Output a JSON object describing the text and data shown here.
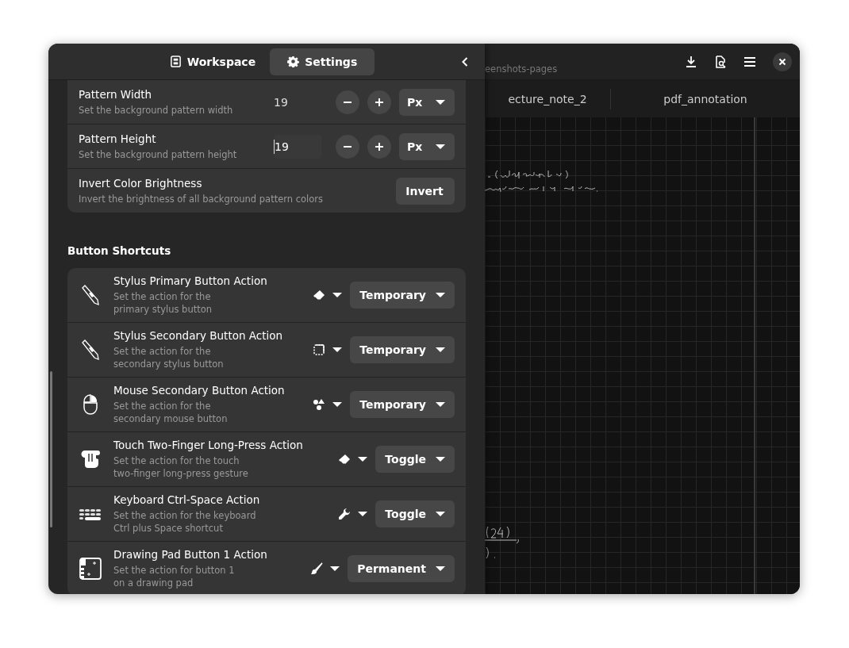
{
  "sidebar_tabs": [
    {
      "label": "Workspace",
      "selected": false
    },
    {
      "label": "Settings",
      "selected": true
    }
  ],
  "pattern_settings": [
    {
      "kind": "spin",
      "title": "Pattern Width",
      "subtitle": "Set the background pattern width",
      "value": "19",
      "unit": "Px",
      "focused": false
    },
    {
      "kind": "spin",
      "title": "Pattern Height",
      "subtitle": "Set the background pattern height",
      "value": "19",
      "unit": "Px",
      "focused": true
    },
    {
      "kind": "button",
      "title": "Invert Color Brightness",
      "subtitle": "Invert the brightness of all background pattern colors",
      "button": "Invert"
    }
  ],
  "section_heading": "Button Shortcuts",
  "shortcuts": [
    {
      "title": "Stylus Primary Button Action",
      "subtitle_lines": [
        "Set the action for the",
        "primary stylus button"
      ],
      "mode": "Temporary"
    },
    {
      "title": "Stylus Secondary Button Action",
      "subtitle_lines": [
        "Set the action for the",
        "secondary stylus button"
      ],
      "mode": "Temporary"
    },
    {
      "title": "Mouse Secondary Button Action",
      "subtitle_lines": [
        "Set the action for the",
        "secondary mouse button"
      ],
      "mode": "Temporary"
    },
    {
      "title": "Touch Two-Finger Long-Press Action",
      "subtitle_lines": [
        "Set the action for the touch",
        "two-finger long-press gesture"
      ],
      "mode": "Toggle"
    },
    {
      "title": "Keyboard Ctrl-Space Action",
      "subtitle_lines": [
        "Set the action for the keyboard",
        "Ctrl plus Space shortcut"
      ],
      "mode": "Toggle"
    },
    {
      "title": "Drawing Pad Button 1 Action",
      "subtitle_lines": [
        "Set the action for button 1",
        "on a drawing pad"
      ],
      "mode": "Permanent"
    }
  ],
  "document_title": "eenshots-pages",
  "doc_tabs": [
    {
      "label": "ecture_note_2",
      "selected": false
    },
    {
      "label": "pdf_annotation",
      "selected": false
    }
  ]
}
